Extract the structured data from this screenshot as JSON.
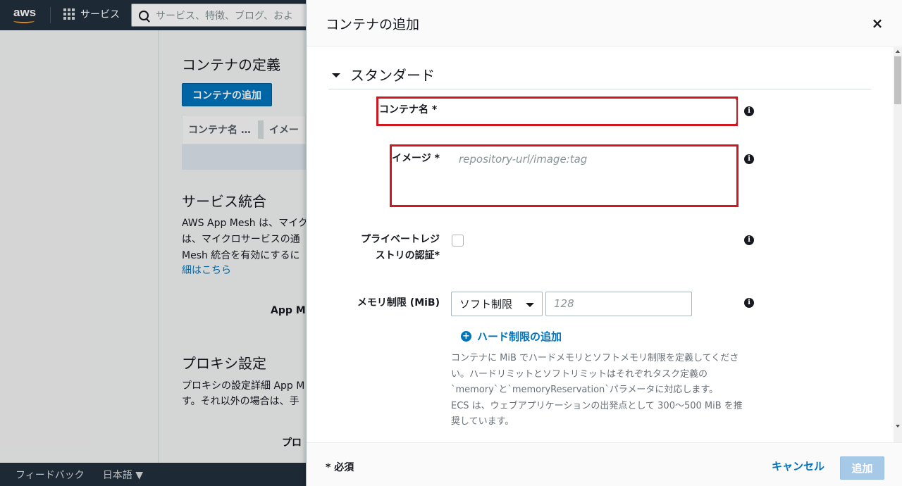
{
  "nav": {
    "logo_text": "aws",
    "services_label": "サービス",
    "search_placeholder": "サービス、特徴、ブログ、およ"
  },
  "background": {
    "container_def_title": "コンテナの定義",
    "add_container_button": "コンテナの追加",
    "table_col1": "コンテナ名 …",
    "table_col2": "イメー",
    "service_integration_title": "サービス統合",
    "service_text_1": "AWS App Mesh は、マイク",
    "service_text_2": "は、マイクロサービスの通",
    "service_text_3": "Mesh 統合を有効にするに",
    "service_link": "細はこちら",
    "app_mesh_label": "App Me",
    "proxy_title": "プロキシ設定",
    "proxy_text_1": "プロキシの設定詳細 App M",
    "proxy_text_2": "す。それ以外の場合は、手",
    "proxy_label": "プロ"
  },
  "footer": {
    "feedback": "フィードバック",
    "language": "日本語"
  },
  "modal": {
    "title": "コンテナの追加",
    "close_glyph": "×",
    "section_title": "スタンダード",
    "fields": {
      "container_name_label": "コンテナ名 *",
      "container_name_value": "",
      "image_label": "イメージ *",
      "image_placeholder": "repository-url/image:tag",
      "private_registry_label_1": "プライベートレジ",
      "private_registry_label_2": "ストリの認証*",
      "memory_label": "メモリ制限 (MiB)",
      "memory_select_value": "ソフト制限",
      "memory_input_placeholder": "128",
      "add_hard_limit_link": "ハード制限の追加",
      "help_lines": [
        "コンテナに MiB でハードメモリとソフトメモリ制限を定義してくださ",
        "い。ハードリミットとソフトリミットはそれぞれタスク定義の",
        "`memory`と`memoryReservation`パラメータに対応します。",
        "ECS は、ウェブアプリケーションの出発点として 300～500 MiB を推",
        "奨しています。"
      ]
    },
    "info_glyph": "i",
    "plus_glyph": "+",
    "required_note": "* 必須",
    "cancel_button": "キャンセル",
    "add_button": "追加"
  },
  "colors": {
    "nav_bg": "#232f3e",
    "primary": "#0073bb",
    "highlight_red": "#d0161e",
    "disabled_btn": "#a6c9e8",
    "aws_orange": "#ff9900"
  },
  "icons": [
    "aws-logo",
    "grid-icon",
    "search-icon",
    "close-icon",
    "caret-down-icon",
    "info-icon",
    "plus-circle-icon",
    "chevron-down-icon"
  ]
}
